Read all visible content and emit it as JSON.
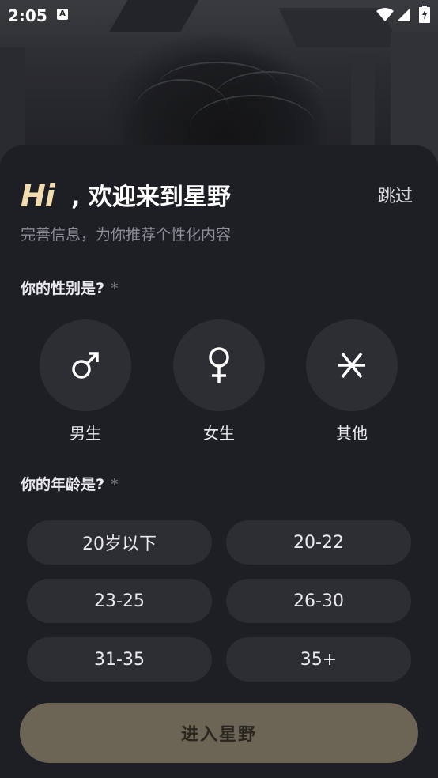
{
  "status_bar": {
    "time": "2:05",
    "notification_icon": "a-icon",
    "icons": [
      "wifi-icon",
      "signal-icon",
      "battery-charging-icon"
    ]
  },
  "header": {
    "hi_logo": "Hi",
    "welcome": ", 欢迎来到星野",
    "skip_label": "跳过",
    "subtitle": "完善信息，为你推荐个性化内容"
  },
  "gender_section": {
    "label": "你的性别是?",
    "required_mark": "*",
    "options": [
      {
        "label": "男生",
        "icon": "male-symbol-icon"
      },
      {
        "label": "女生",
        "icon": "female-symbol-icon"
      },
      {
        "label": "其他",
        "icon": "asterisk-icon"
      }
    ]
  },
  "age_section": {
    "label": "你的年龄是?",
    "required_mark": "*",
    "options": [
      "20岁以下",
      "20-22",
      "23-25",
      "26-30",
      "31-35",
      "35+"
    ]
  },
  "enter_button": {
    "label": "进入星野"
  },
  "colors": {
    "sheet_bg": "#1e1f25",
    "option_bg": "#2d2e34",
    "hi_accent": "#f3dcb0",
    "enter_button_bg": "#6c6455"
  }
}
